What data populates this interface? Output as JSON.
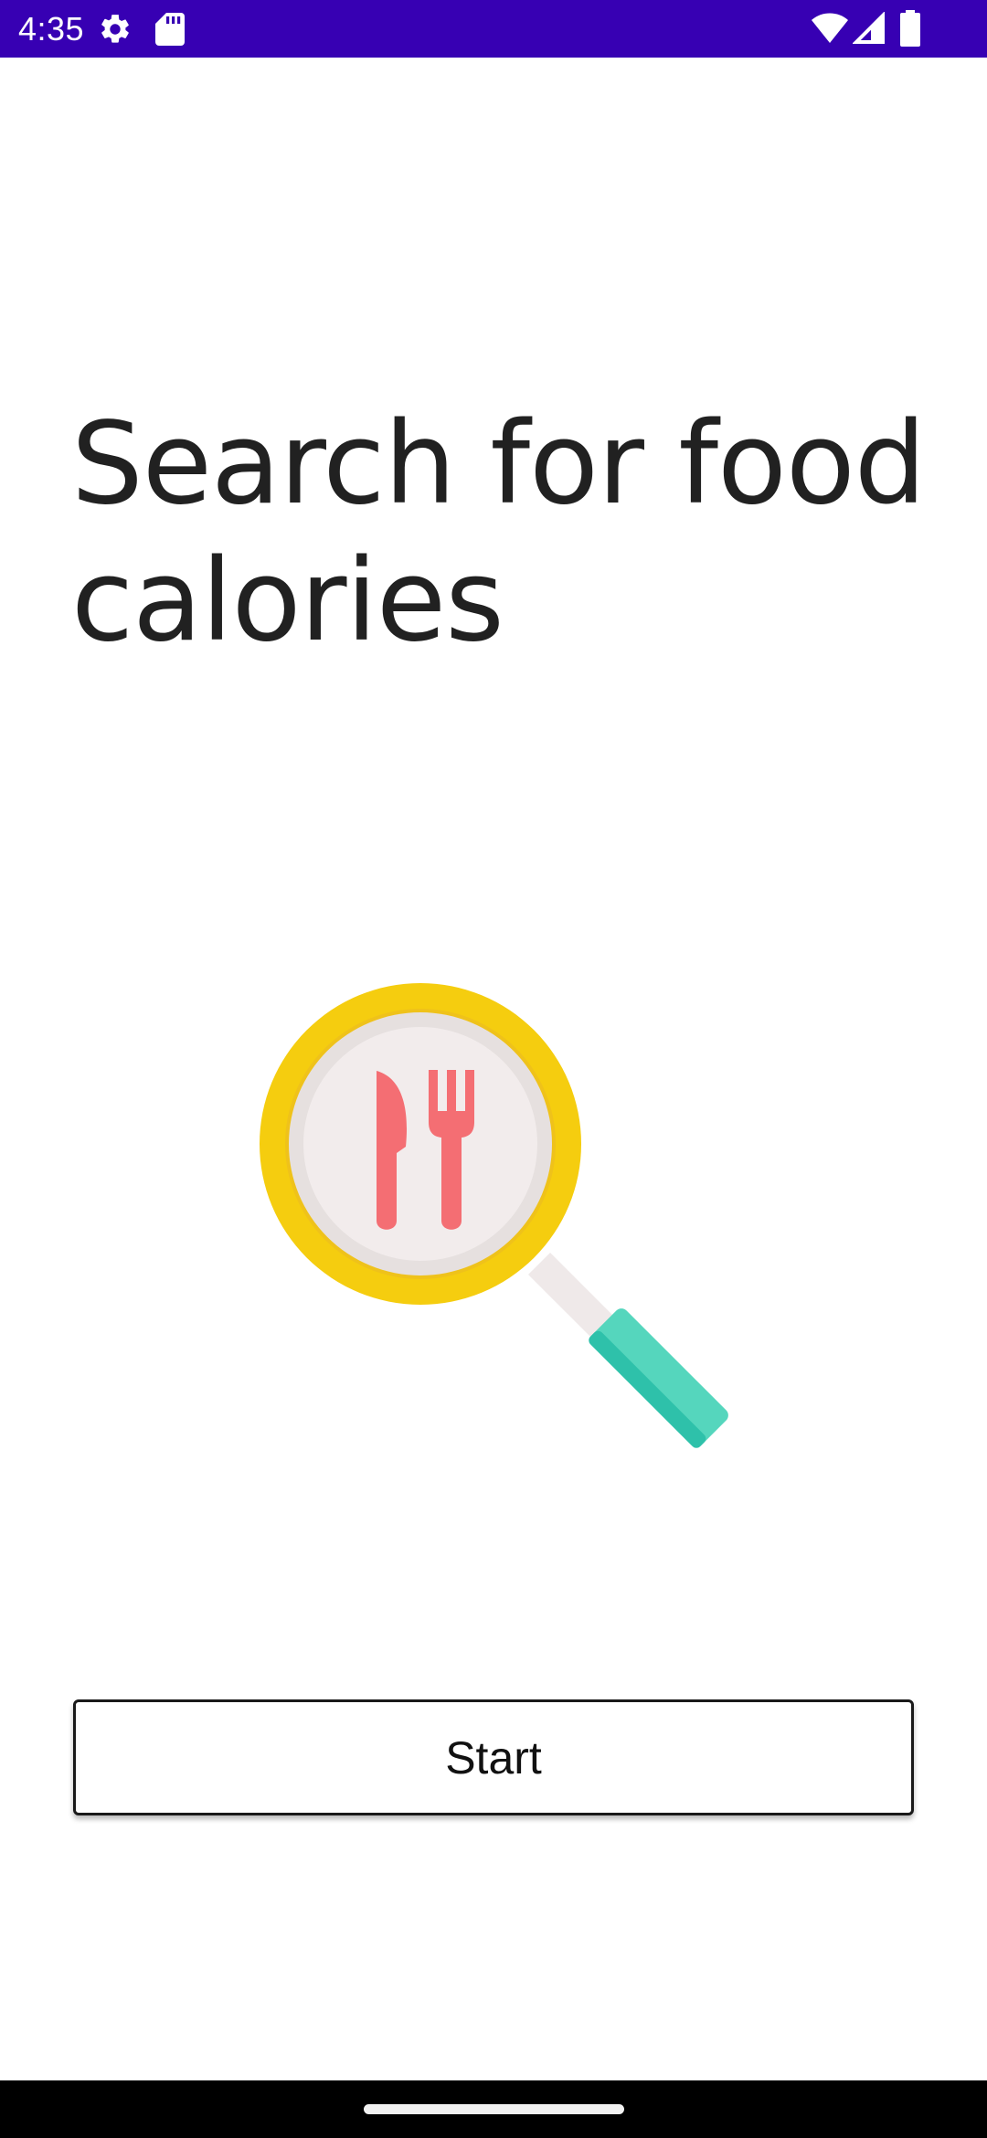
{
  "status_bar": {
    "time": "4:35",
    "background": "#3700b3",
    "left_icons": [
      "settings-gear-icon",
      "sd-card-icon"
    ],
    "right_icons": [
      "wifi-icon",
      "cellular-signal-icon",
      "battery-icon"
    ]
  },
  "main": {
    "title": "Search for food calories",
    "illustration": {
      "icon": "magnifier-with-knife-and-fork-icon",
      "colors": {
        "ring": "#f5cd0f",
        "ring_inner": "#e6e0df",
        "lens": "#f2ecec",
        "utensils": "#f46e73",
        "handle": "#55d6bd",
        "handle_shade": "#2ec1aa",
        "neck": "#efe9e9"
      }
    },
    "start_button": {
      "label": "Start"
    }
  },
  "navigation_bar": {
    "home_handle": "home-gesture-handle"
  }
}
